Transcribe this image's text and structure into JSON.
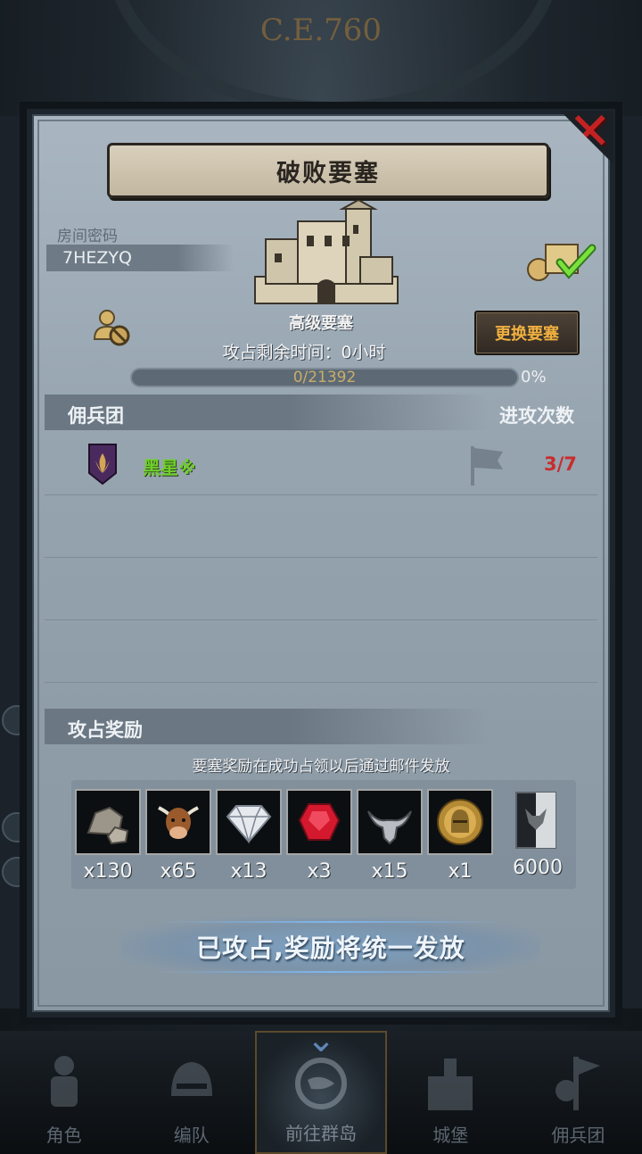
{
  "background": {
    "year_label": "C.E.760"
  },
  "bottom_nav": {
    "items": [
      {
        "label": "角色",
        "icon": "knight-icon",
        "active": false
      },
      {
        "label": "编队",
        "icon": "helmet-icon",
        "active": false
      },
      {
        "label": "前往群岛",
        "icon": "globe-icon",
        "active": true
      },
      {
        "label": "城堡",
        "icon": "castle-icon",
        "active": false
      },
      {
        "label": "佣兵团",
        "icon": "mercenary-icon",
        "active": false
      }
    ]
  },
  "dialog": {
    "title": "破败要塞",
    "room_label": "房间密码",
    "room_code": "7HEZYQ",
    "fortress_type": "高级要塞",
    "remaining_label": "攻占剩余时间：0小时",
    "change_button": "更换要塞",
    "progress": {
      "text": "0/21392",
      "percent_label": "0%",
      "fraction": 0
    },
    "mercenary_section": {
      "header": "佣兵团",
      "attack_header": "进攻次数",
      "rows": [
        {
          "name": "黑星※",
          "attacks": "3/7"
        }
      ]
    },
    "reward_section": {
      "header": "攻占奖励",
      "note": "要塞奖励在成功占领以后通过邮件发放",
      "items": [
        {
          "icon": "stone-icon",
          "qty": "x130"
        },
        {
          "icon": "cow-icon",
          "qty": "x65"
        },
        {
          "icon": "diamond-icon",
          "qty": "x13"
        },
        {
          "icon": "ruby-icon",
          "qty": "x3"
        },
        {
          "icon": "horn-icon",
          "qty": "x15"
        },
        {
          "icon": "knight-medal-icon",
          "qty": "x1"
        },
        {
          "icon": "banner-badge-icon",
          "qty": "6000"
        }
      ]
    },
    "status_banner": "已攻占,奖励将统一发放"
  },
  "colors": {
    "accent_gold": "#f0b040",
    "merc_name_green": "#6fcf2b",
    "attack_red": "#c82d2d",
    "close_red": "#c42222"
  }
}
